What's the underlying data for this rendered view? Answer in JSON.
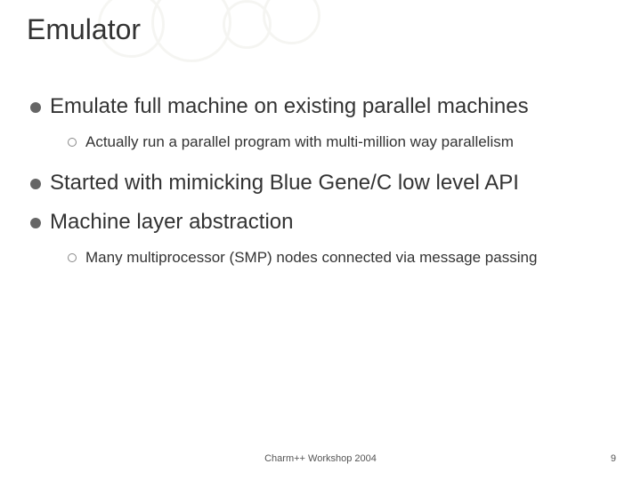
{
  "title": "Emulator",
  "bullets": [
    {
      "level": 1,
      "text": "Emulate full machine on existing parallel machines"
    },
    {
      "level": 2,
      "text": "Actually run a parallel program with multi-million way parallelism"
    },
    {
      "level": 1,
      "text": "Started with mimicking Blue Gene/C low level API"
    },
    {
      "level": 1,
      "text": "Machine layer abstraction"
    },
    {
      "level": 2,
      "text": "Many multiprocessor (SMP) nodes connected via message passing"
    }
  ],
  "footer": "Charm++ Workshop 2004",
  "pageNumber": "9"
}
